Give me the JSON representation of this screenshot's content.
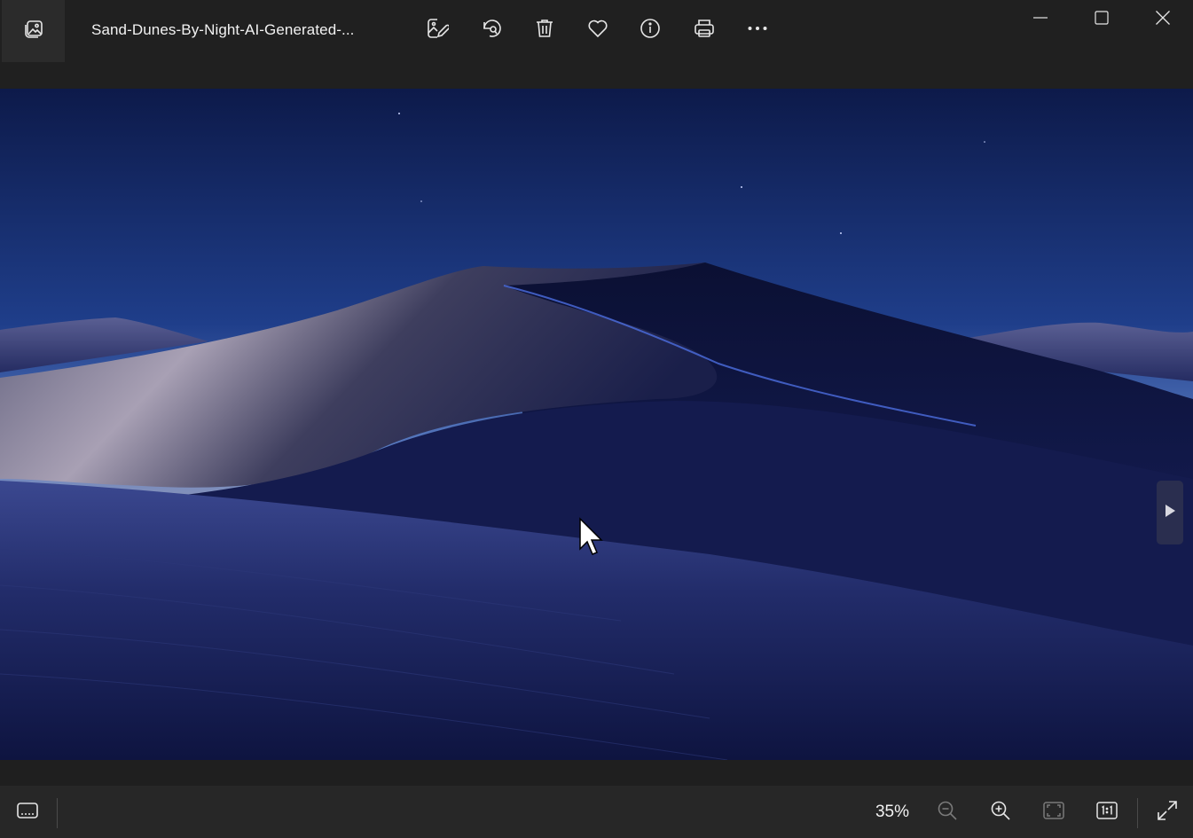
{
  "window": {
    "file_name": "Sand-Dunes-By-Night-AI-Generated-...",
    "controls": {
      "minimize": "minimize-icon",
      "maximize": "maximize-icon",
      "close": "close-icon"
    }
  },
  "toolbar": {
    "buttons": [
      {
        "name": "edit-image-button",
        "icon": "edit-image-icon"
      },
      {
        "name": "rotate-button",
        "icon": "rotate-icon"
      },
      {
        "name": "delete-button",
        "icon": "trash-icon"
      },
      {
        "name": "favorite-button",
        "icon": "heart-icon"
      },
      {
        "name": "file-info-button",
        "icon": "info-icon"
      },
      {
        "name": "print-button",
        "icon": "printer-icon"
      },
      {
        "name": "more-options-button",
        "icon": "more-icon"
      }
    ]
  },
  "image": {
    "description_icon": "image-viewer",
    "next_button_icon": "next-arrow-icon"
  },
  "bottom_bar": {
    "filmstrip_icon": "filmstrip-icon",
    "zoom_level": "35%",
    "zoom_out_icon": "zoom-out-icon",
    "zoom_in_icon": "zoom-in-icon",
    "fit_to_window_icon": "fit-window-icon",
    "actual_size_icon": "actual-size-icon",
    "fullscreen_icon": "fullscreen-icon"
  },
  "colors": {
    "chrome": "#202020",
    "bottom_bar": "#272727",
    "icon": "#e6e6e6",
    "icon_disabled": "#7a7a7a"
  }
}
